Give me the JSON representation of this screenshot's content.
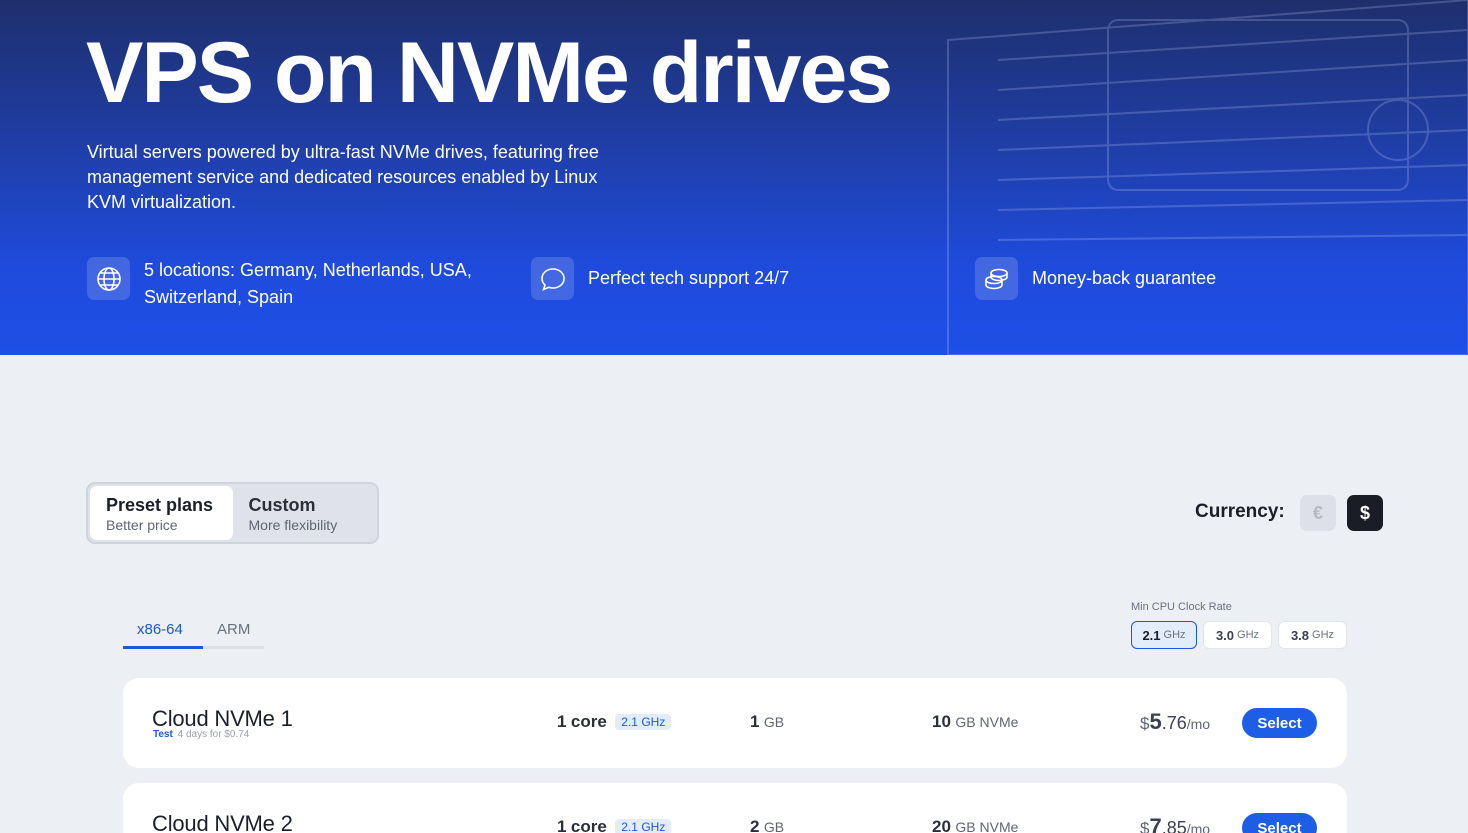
{
  "hero": {
    "title": "VPS on NVMe drives",
    "description": "Virtual servers powered by ultra-fast NVMe drives, featuring free management service and dedicated resources enabled by Linux KVM virtualization.",
    "features": [
      {
        "icon": "globe-icon",
        "text": "5 locations: Germany, Netherlands, USA, Switzerland, Spain"
      },
      {
        "icon": "chat-bubble-icon",
        "text": "Perfect tech support 24/7"
      },
      {
        "icon": "coins-icon",
        "text": "Money-back guarantee"
      }
    ]
  },
  "plan_mode": {
    "options": [
      {
        "title": "Preset plans",
        "subtitle": "Better price",
        "active": true
      },
      {
        "title": "Custom",
        "subtitle": "More flexibility",
        "active": false
      }
    ]
  },
  "currency": {
    "label": "Currency:",
    "options": [
      {
        "symbol": "€",
        "active": false
      },
      {
        "symbol": "$",
        "active": true
      }
    ]
  },
  "architecture": {
    "tabs": [
      {
        "label": "x86-64",
        "active": true
      },
      {
        "label": "ARM",
        "active": false
      }
    ]
  },
  "cpu_filter": {
    "label": "Min CPU Clock Rate",
    "options": [
      {
        "value": "2.1",
        "unit": "GHz",
        "active": true
      },
      {
        "value": "3.0",
        "unit": "GHz",
        "active": false
      },
      {
        "value": "3.8",
        "unit": "GHz",
        "active": false
      }
    ]
  },
  "plans": [
    {
      "name": "Cloud NVMe 1",
      "test_label": "Test",
      "test_detail": "4 days for $0.74",
      "cpu_value": "1",
      "cpu_unit": "core",
      "cpu_ghz": "2.1 GHz",
      "ram_value": "1",
      "ram_unit": "GB",
      "disk_value": "10",
      "disk_unit": "GB NVMe",
      "price_currency": "$",
      "price_int": "5",
      "price_dec": ".76",
      "price_period": "/mo",
      "select_label": "Select"
    },
    {
      "name": "Cloud NVMe 2",
      "cpu_value": "1",
      "cpu_unit": "core",
      "cpu_ghz": "2.1 GHz",
      "ram_value": "2",
      "ram_unit": "GB",
      "disk_value": "20",
      "disk_unit": "GB NVMe",
      "price_currency": "$",
      "price_int": "7",
      "price_dec": ".85",
      "price_period": "/mo",
      "select_label": "Select"
    }
  ],
  "colors": {
    "accent": "#1e5ee6",
    "hero_top": "#1e2f6c",
    "hero_bottom": "#1e4fe6",
    "page_bg": "#eceff3"
  }
}
